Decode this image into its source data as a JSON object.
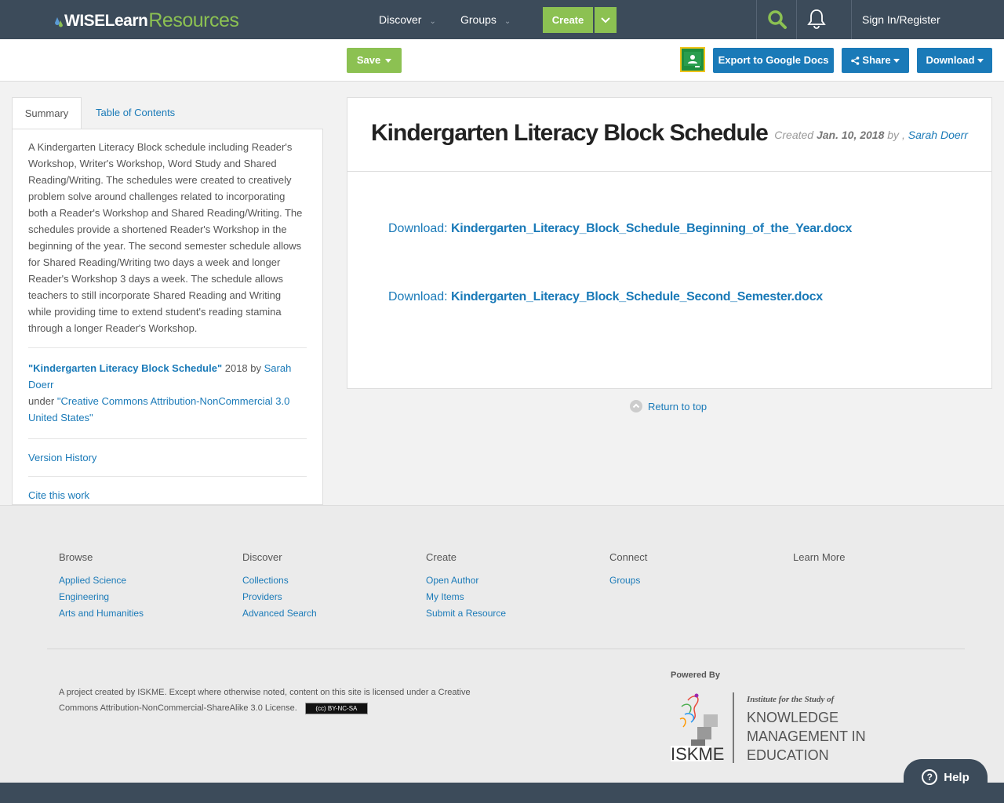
{
  "nav": {
    "logo_wise": "WISELearn",
    "logo_resources": "Resources",
    "discover": "Discover",
    "groups": "Groups",
    "create": "Create",
    "signin": "Sign In/Register"
  },
  "actions": {
    "save": "Save",
    "export": "Export to Google Docs",
    "share": "Share",
    "download": "Download"
  },
  "tabs": {
    "summary": "Summary",
    "toc": "Table of Contents"
  },
  "summary": {
    "text": "A Kindergarten Literacy Block schedule including Reader's Workshop, Writer's Workshop, Word Study and Shared Reading/Writing. The schedules were created to creatively problem solve around challenges related to incorporating both a Reader's Workshop and Shared Reading/Writing. The schedules provide a shortened Reader's Workshop in the beginning of the year. The second semester schedule allows for Shared Reading/Writing two days a week and longer Reader's Workshop 3 days a week. The schedule allows teachers to still incorporate Shared Reading and Writing while providing time to extend student's reading stamina through a longer Reader's Workshop.",
    "attrib_title": "\"Kindergarten Literacy Block Schedule\"",
    "attrib_year_by": " 2018 by ",
    "attrib_author": "Sarah Doerr",
    "attrib_under": "under ",
    "attrib_license": "\"Creative Commons Attribution-NonCommercial 3.0 United States\"",
    "version_history": "Version History",
    "cite": "Cite this work"
  },
  "resource": {
    "title": "Kindergarten Literacy Block Schedule",
    "created_label": "Created ",
    "created_date": "Jan. 10, 2018",
    "by_label": " by , ",
    "author": "Sarah Doerr",
    "download_label": "Download: ",
    "file1": "Kindergarten_Literacy_Block_Schedule_Beginning_of_the_Year.docx",
    "file2": "Kindergarten_Literacy_Block_Schedule_Second_Semester.docx",
    "return_top": "Return to top"
  },
  "footer": {
    "browse": {
      "heading": "Browse",
      "links": [
        "Applied Science",
        "Engineering",
        "Arts and Humanities"
      ]
    },
    "discover": {
      "heading": "Discover",
      "links": [
        "Collections",
        "Providers",
        "Advanced Search"
      ]
    },
    "create": {
      "heading": "Create",
      "links": [
        "Open Author",
        "My Items",
        "Submit a Resource"
      ]
    },
    "connect": {
      "heading": "Connect",
      "links": [
        "Groups"
      ]
    },
    "learn": {
      "heading": "Learn More"
    },
    "license_text": "A project created by ISKME. Except where otherwise noted, content on this site is licensed under a Creative Commons Attribution-NonCommercial-ShareAlike 3.0 License.",
    "cc_badge": "(cc) BY-NC-SA",
    "powered_by": "Powered By",
    "iskme_line1": "Institute for the Study of",
    "iskme_line2": "KNOWLEDGE",
    "iskme_line3": "MANAGEMENT IN",
    "iskme_line4": "EDUCATION",
    "iskme_abbr": "ISKME"
  },
  "help": "Help",
  "colors": {
    "nav_bg": "#3c4b5a",
    "green": "#8cc152",
    "blue": "#1a7ab8"
  }
}
